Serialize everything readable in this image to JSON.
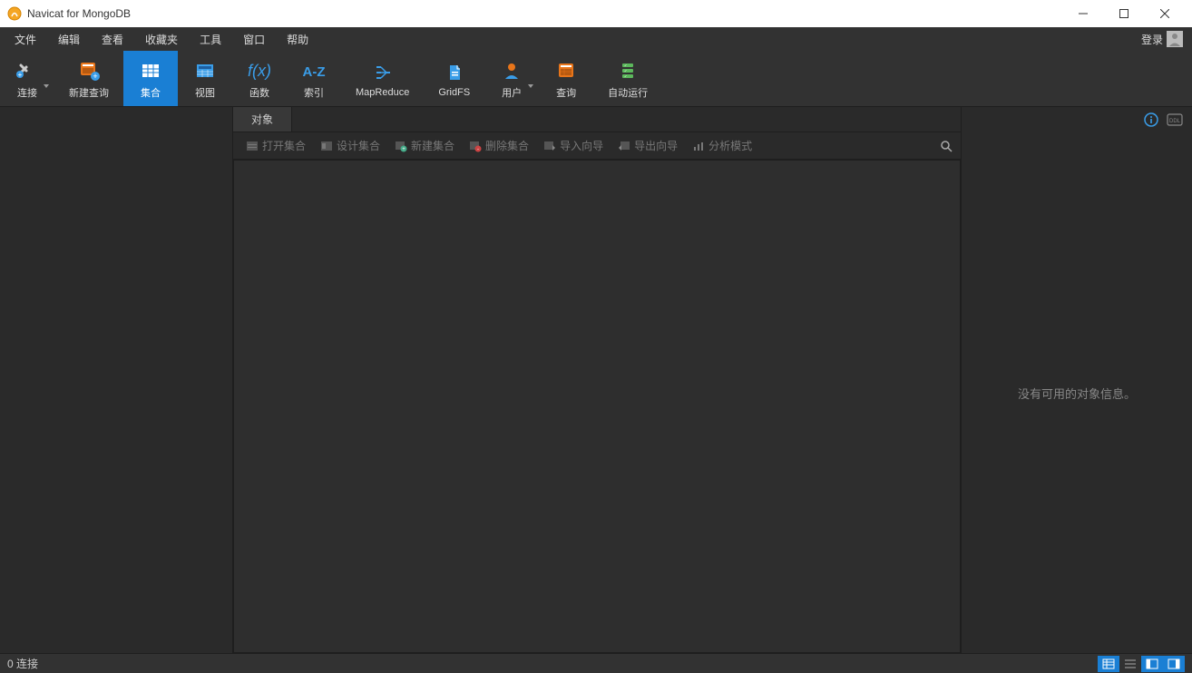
{
  "window": {
    "title": "Navicat for MongoDB"
  },
  "menubar": {
    "items": [
      "文件",
      "编辑",
      "查看",
      "收藏夹",
      "工具",
      "窗口",
      "帮助"
    ],
    "login": "登录"
  },
  "toolbar": {
    "items": [
      {
        "label": "连接",
        "icon": "connection",
        "has_caret": true
      },
      {
        "label": "新建查询",
        "icon": "new-query"
      },
      {
        "label": "集合",
        "icon": "collection",
        "active": true
      },
      {
        "label": "视图",
        "icon": "view"
      },
      {
        "label": "函数",
        "icon": "function"
      },
      {
        "label": "索引",
        "icon": "index"
      },
      {
        "label": "MapReduce",
        "icon": "mapreduce"
      },
      {
        "label": "GridFS",
        "icon": "gridfs"
      },
      {
        "label": "用户",
        "icon": "user",
        "has_caret": true
      },
      {
        "label": "查询",
        "icon": "query"
      },
      {
        "label": "自动运行",
        "icon": "autorun"
      }
    ]
  },
  "tabs": {
    "active": "对象"
  },
  "subtoolbar": {
    "actions": [
      {
        "label": "打开集合",
        "icon": "open"
      },
      {
        "label": "设计集合",
        "icon": "design"
      },
      {
        "label": "新建集合",
        "icon": "new"
      },
      {
        "label": "删除集合",
        "icon": "delete"
      },
      {
        "label": "导入向导",
        "icon": "import"
      },
      {
        "label": "导出向导",
        "icon": "export"
      },
      {
        "label": "分析模式",
        "icon": "analyze"
      }
    ]
  },
  "right_panel": {
    "no_info": "没有可用的对象信息。"
  },
  "statusbar": {
    "connections": "0 连接"
  },
  "colors": {
    "accent": "#1a7fd4",
    "orange": "#e8751a"
  }
}
